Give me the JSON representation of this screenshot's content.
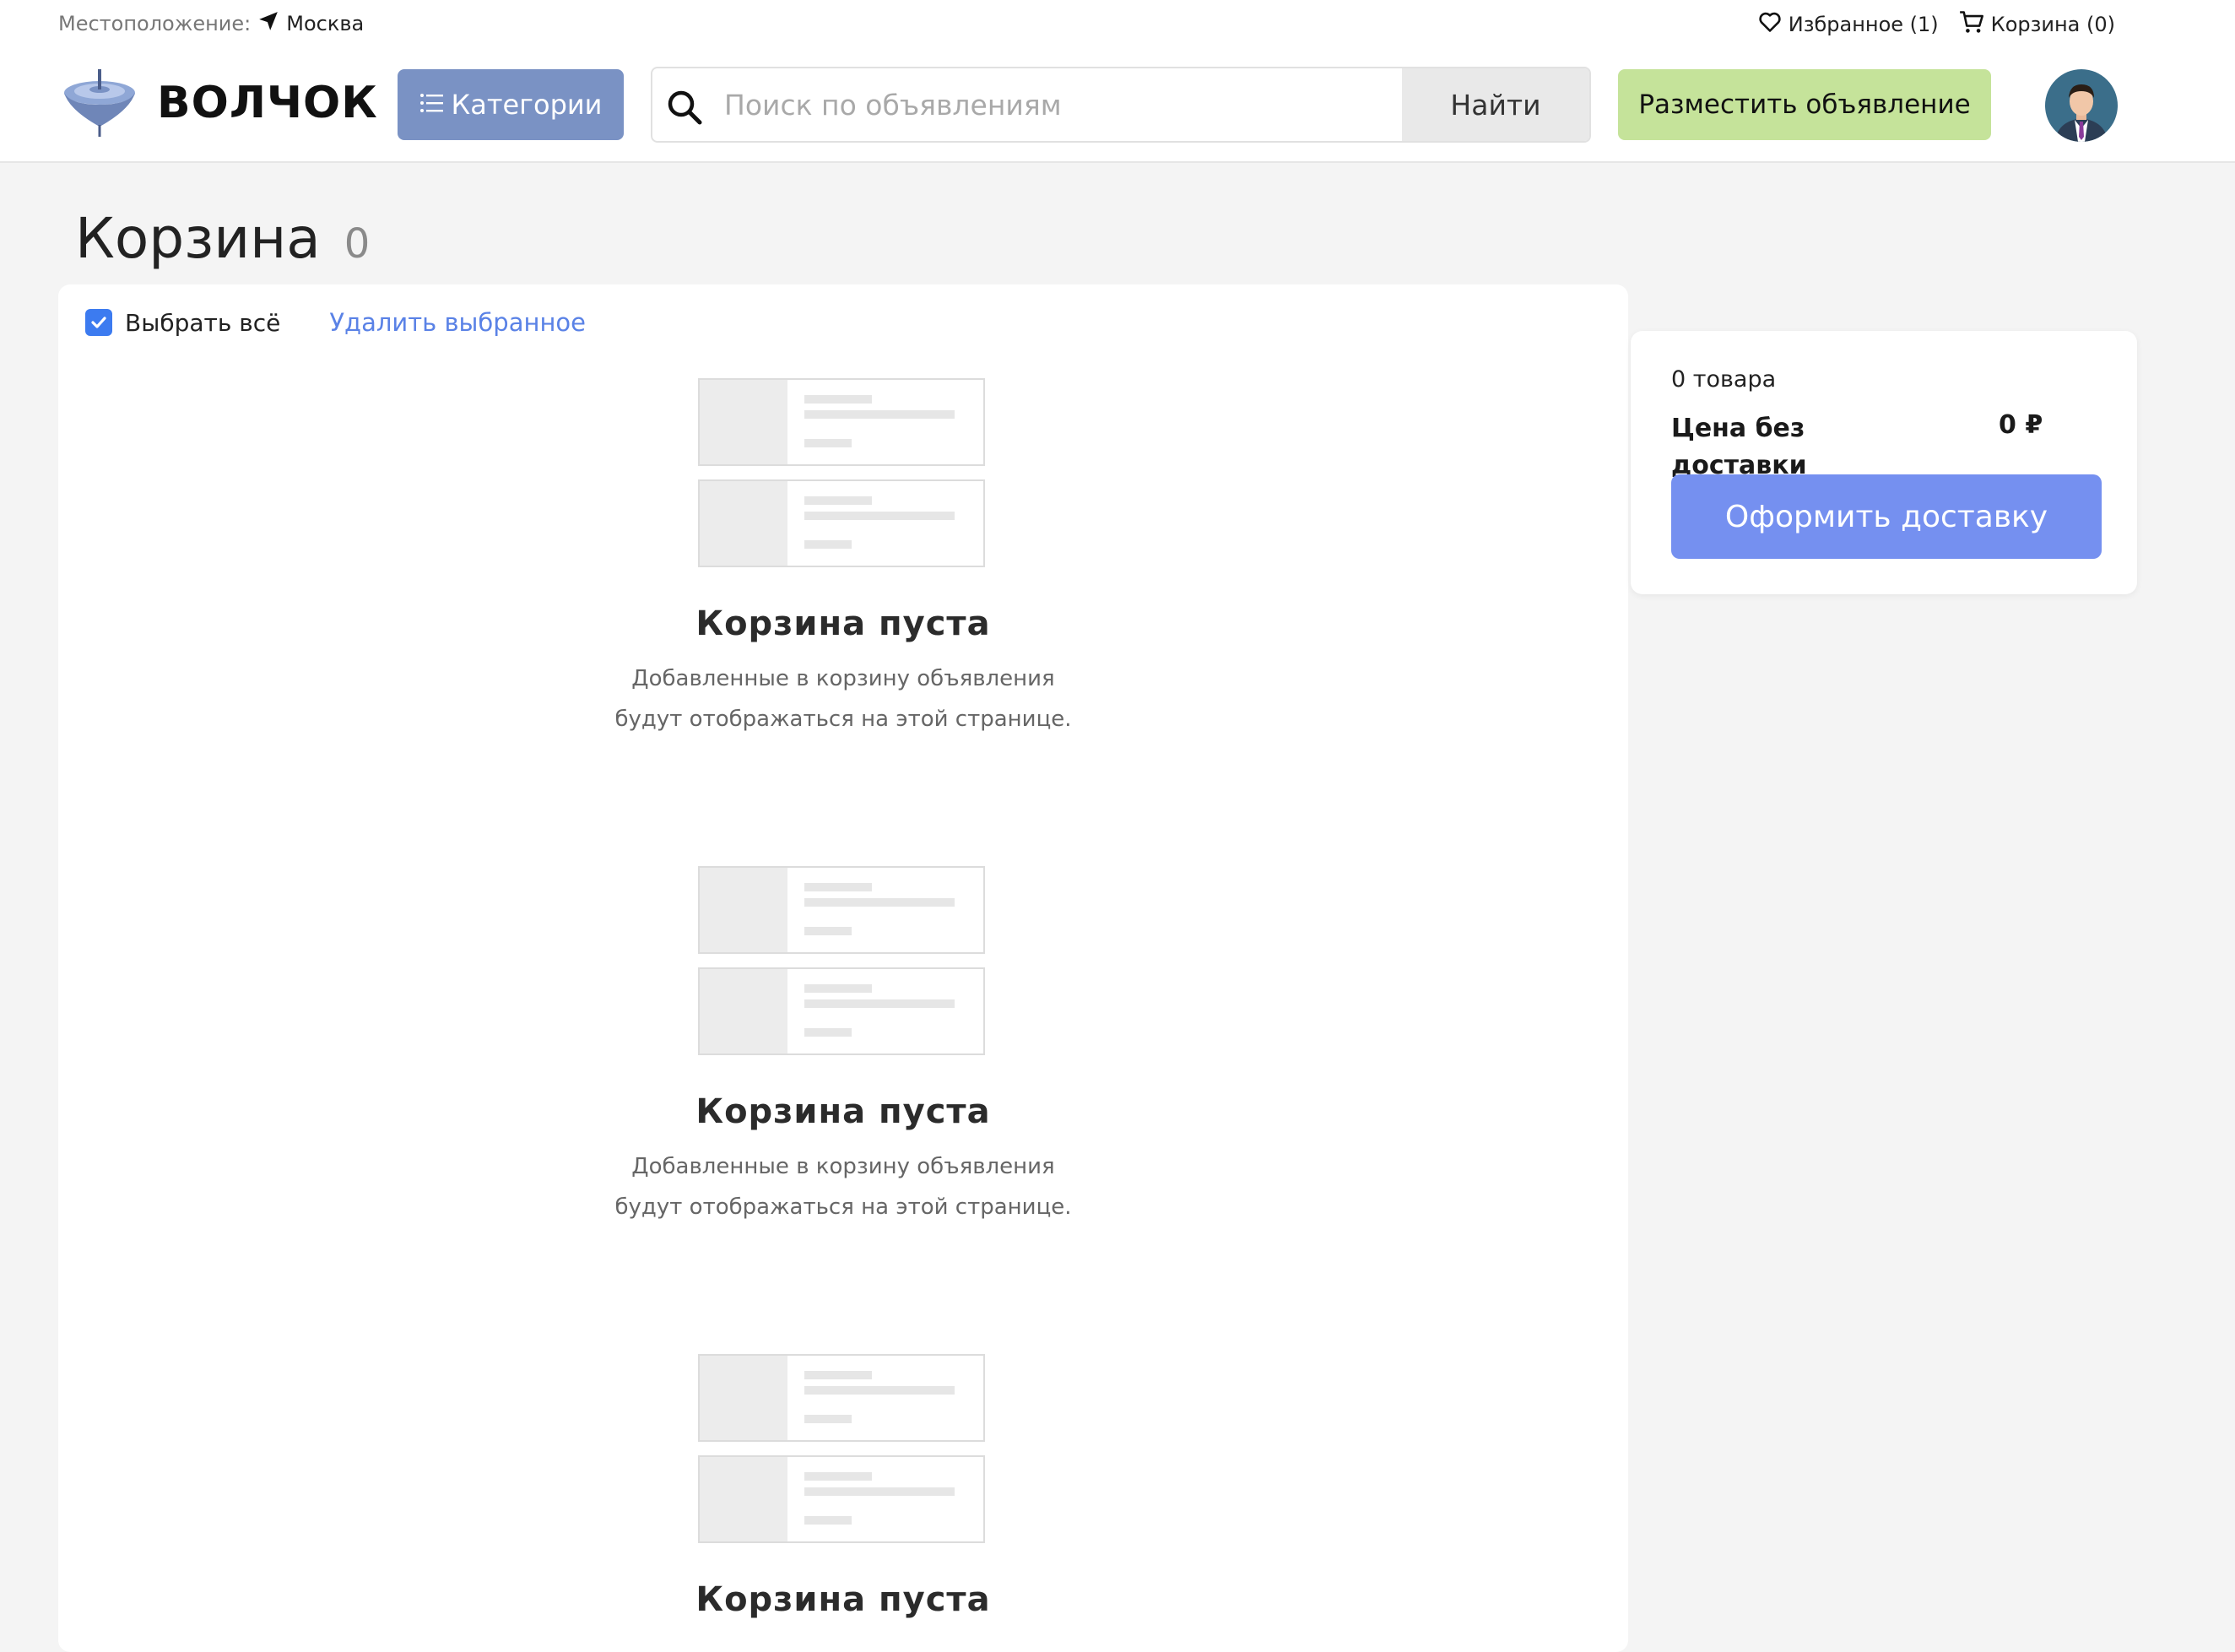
{
  "topbar": {
    "location_label": "Местоположение:",
    "city": "Москва",
    "favorites": "Избранное (1)",
    "cart": "Корзина (0)"
  },
  "header": {
    "brand": "ВОЛЧОК",
    "categories_label": "Категории",
    "search_placeholder": "Поиск по объявлениям",
    "search_button": "Найти",
    "post_button": "Разместить объявление"
  },
  "page": {
    "title": "Корзина",
    "count": "0"
  },
  "cart": {
    "select_all": "Выбрать всё",
    "select_all_checked": true,
    "delete_selected": "Удалить выбранное",
    "empty_blocks": [
      {
        "title": "Корзина пуста",
        "line1": "Добавленные в корзину объявления",
        "line2": "будут отображаться на этой странице."
      },
      {
        "title": "Корзина пуста",
        "line1": "Добавленные в корзину объявления",
        "line2": "будут отображаться на этой странице."
      },
      {
        "title": "Корзина пуста"
      }
    ]
  },
  "summary": {
    "items_count": "0 товара",
    "price_label": "Цена без доставки",
    "price_value": "0 ₽",
    "order_button": "Оформить доставку"
  },
  "colors": {
    "accent": "#7590f0",
    "categories_button": "#7a92c4",
    "post_button": "#c5e39a",
    "link": "#5a82e6",
    "checkbox": "#3c7bf0"
  }
}
